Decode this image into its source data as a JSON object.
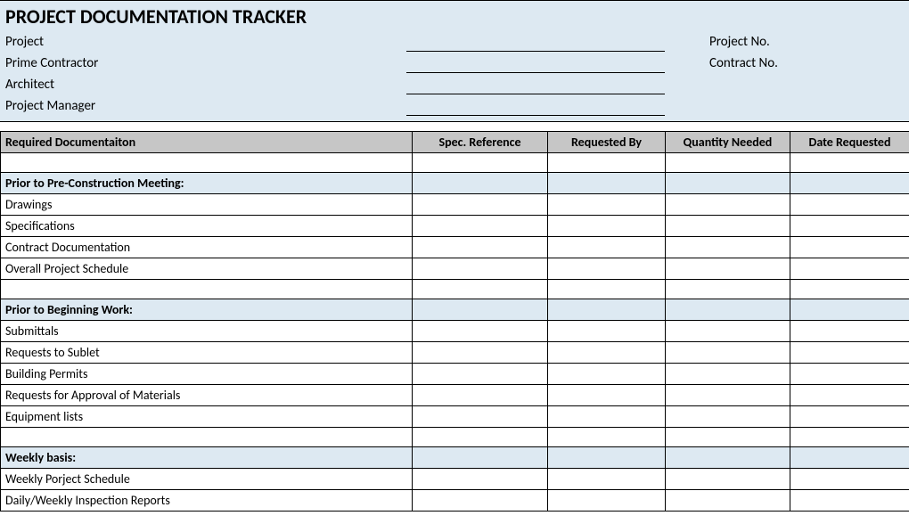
{
  "header": {
    "title": "PROJECT DOCUMENTATION TRACKER",
    "labels": {
      "project": "Project",
      "prime_contractor": "Prime Contractor",
      "architect": "Architect",
      "project_manager": "Project Manager",
      "project_no": "Project No.",
      "contract_no": "Contract No."
    }
  },
  "columns": {
    "doc": "Required Documentaiton",
    "spec": "Spec. Reference",
    "requested_by": "Requested By",
    "quantity": "Quantity Needed",
    "date": "Date Requested"
  },
  "sections": [
    {
      "heading": "Prior to Pre-Construction Meeting:",
      "items": [
        "Drawings",
        "Specifications",
        "Contract Documentation",
        "Overall Project Schedule"
      ]
    },
    {
      "heading": "Prior to Beginning Work:",
      "items": [
        "Submittals",
        "Requests to Sublet",
        "Building Permits",
        "Requests for Approval of Materials",
        "Equipment lists"
      ]
    },
    {
      "heading": "Weekly basis:",
      "items": [
        "Weekly Porject Schedule",
        "Daily/Weekly Inspection Reports"
      ]
    }
  ]
}
